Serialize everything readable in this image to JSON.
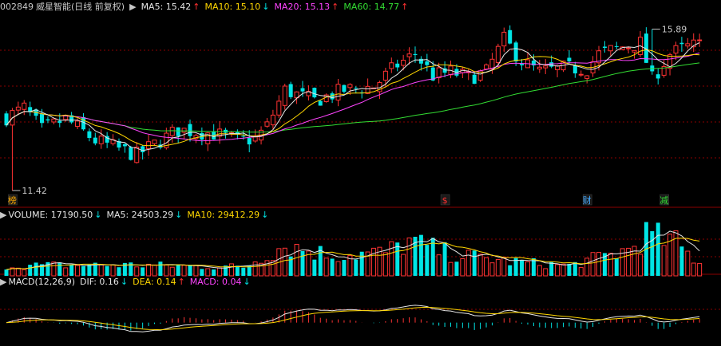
{
  "price_legend": {
    "code": "002849",
    "name": "威星智能",
    "period": "(日线 前复权)",
    "items": [
      {
        "label": "MA5: 15.42",
        "arrow": "↑",
        "color": "#e6e6e6",
        "arrow_color": "#ff3030"
      },
      {
        "label": "MA10: 15.10",
        "arrow": "↓",
        "color": "#ffd700",
        "arrow_color": "#00e0e0"
      },
      {
        "label": "MA20: 15.13",
        "arrow": "↑",
        "color": "#ff44ff",
        "arrow_color": "#ff3030"
      },
      {
        "label": "MA60: 14.77",
        "arrow": "↑",
        "color": "#33dd33",
        "arrow_color": "#ff3030"
      }
    ]
  },
  "volume_legend": {
    "items": [
      {
        "label": "VOLUME: 17190.50",
        "arrow": "↓",
        "color": "#e6e6e6",
        "arrow_color": "#00e0e0"
      },
      {
        "label": "MA5: 24503.29",
        "arrow": "↓",
        "color": "#e6e6e6",
        "arrow_color": "#00e0e0"
      },
      {
        "label": "MA10: 29412.29",
        "arrow": "↓",
        "color": "#ffd700",
        "arrow_color": "#00e0e0"
      }
    ]
  },
  "macd_legend": {
    "items": [
      {
        "label": "MACD(12,26,9)",
        "arrow": "",
        "color": "#e6e6e6",
        "arrow_color": ""
      },
      {
        "label": "DIF: 0.16",
        "arrow": "↓",
        "color": "#e6e6e6",
        "arrow_color": "#00e0e0"
      },
      {
        "label": "DEA: 0.14",
        "arrow": "↑",
        "color": "#ffd700",
        "arrow_color": "#ff3030"
      },
      {
        "label": "MACD: 0.04",
        "arrow": "↓",
        "color": "#ff44ff",
        "arrow_color": "#00e0e0"
      }
    ]
  },
  "colors": {
    "up": "#ff3333",
    "down": "#00e5e5",
    "grid": "#8b0000",
    "ma5": "#e6e6e6",
    "ma10": "#ffd700",
    "ma20": "#ff44ff",
    "ma60": "#33dd33",
    "dif": "#e6e6e6",
    "dea": "#ffd700"
  },
  "chart_data": {
    "type": "candlestick",
    "price_ylim": [
      11.0,
      16.3
    ],
    "high_label": "15.89",
    "low_label": "11.42",
    "markers": [
      {
        "day": 1,
        "text": "榜",
        "color": "#ffaa00"
      },
      {
        "day": 74,
        "text": "$",
        "color": "#ff3030"
      },
      {
        "day": 98,
        "text": "财",
        "color": "#44aaff"
      },
      {
        "day": 111,
        "text": "减",
        "color": "#33dd33"
      }
    ],
    "volume_ylim": [
      0,
      75000
    ],
    "macd_ylim": [
      -0.55,
      0.8
    ],
    "days": 118,
    "ohlc_start": 13.45,
    "vol_keypoints": [
      [
        0,
        15000
      ],
      [
        20,
        16000
      ],
      [
        40,
        13000
      ],
      [
        47,
        45000
      ],
      [
        55,
        30000
      ],
      [
        64,
        34000
      ],
      [
        68,
        50000
      ],
      [
        75,
        32000
      ],
      [
        85,
        21000
      ],
      [
        95,
        15000
      ],
      [
        105,
        38000
      ],
      [
        108,
        60000
      ],
      [
        113,
        48000
      ],
      [
        117,
        17190
      ]
    ],
    "price_keypoints": [
      [
        0,
        13.45
      ],
      [
        3,
        13.7
      ],
      [
        6,
        13.1
      ],
      [
        10,
        13.4
      ],
      [
        15,
        12.8
      ],
      [
        22,
        12.4
      ],
      [
        24,
        12.6
      ],
      [
        29,
        13.1
      ],
      [
        35,
        13.0
      ],
      [
        39,
        12.8
      ],
      [
        42,
        12.85
      ],
      [
        44,
        13.2
      ],
      [
        47,
        14.2
      ],
      [
        52,
        13.9
      ],
      [
        57,
        14.2
      ],
      [
        62,
        14.3
      ],
      [
        66,
        14.9
      ],
      [
        69,
        15.2
      ],
      [
        72,
        14.6
      ],
      [
        75,
        14.7
      ],
      [
        78,
        14.55
      ],
      [
        81,
        14.7
      ],
      [
        84,
        15.6
      ],
      [
        87,
        15.0
      ],
      [
        90,
        14.7
      ],
      [
        94,
        14.8
      ],
      [
        98,
        14.8
      ],
      [
        100,
        15.2
      ],
      [
        104,
        15.4
      ],
      [
        107,
        15.5
      ],
      [
        109,
        14.5
      ],
      [
        112,
        15.2
      ],
      [
        115,
        15.4
      ],
      [
        117,
        15.45
      ]
    ]
  }
}
